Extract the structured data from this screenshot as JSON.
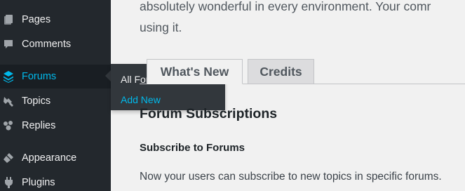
{
  "sidebar": {
    "items": [
      {
        "label": "Pages",
        "icon": "pages-icon"
      },
      {
        "label": "Comments",
        "icon": "comments-icon"
      },
      {
        "label": "Forums",
        "icon": "forums-icon",
        "current": true
      },
      {
        "label": "Topics",
        "icon": "topics-icon"
      },
      {
        "label": "Replies",
        "icon": "replies-icon"
      },
      {
        "label": "Appearance",
        "icon": "appearance-icon"
      },
      {
        "label": "Plugins",
        "icon": "plugins-icon"
      }
    ],
    "flyout": {
      "items": [
        {
          "label": "All Forums"
        },
        {
          "label": "Add New"
        }
      ]
    }
  },
  "main": {
    "intro_line1": "absolutely wonderful in every environment. Your comr",
    "intro_line2": "using it.",
    "tabs": [
      {
        "label": "What's New"
      },
      {
        "label": "Credits"
      }
    ],
    "section_title": "Forum Subscriptions",
    "subsection_title": "Subscribe to Forums",
    "body_text": "Now your users can subscribe to new topics in specific forums."
  },
  "colors": {
    "sidebar_bg": "#23282d",
    "accent": "#00b9eb",
    "flyout_bg": "#32373c",
    "content_bg": "#f1f1f1"
  }
}
